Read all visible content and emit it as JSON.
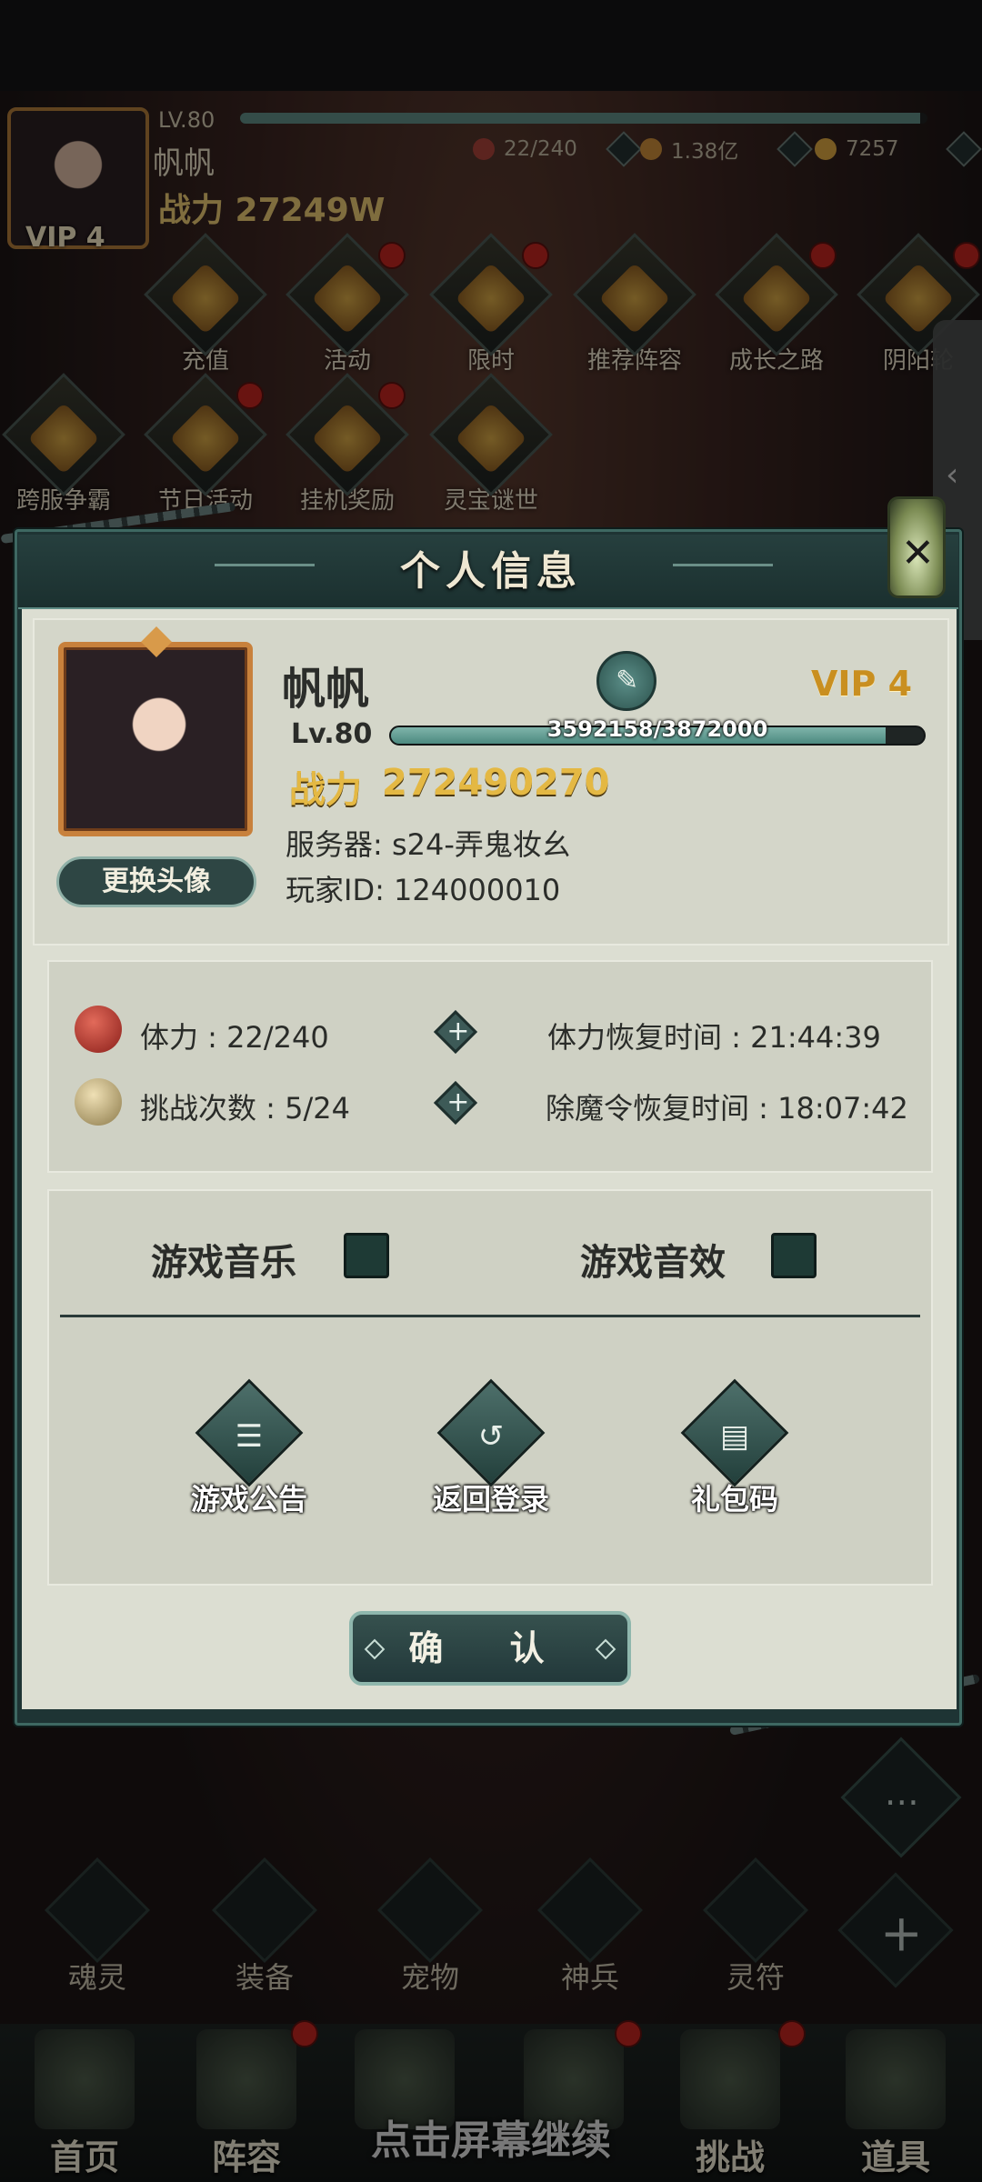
{
  "hud": {
    "level": "LV.80",
    "name": "帆帆",
    "power": "战力 27249W",
    "vip": "VIP 4",
    "xp_fraction": 0.99,
    "resources": [
      {
        "icon": "stamina-orb-icon",
        "value": "22/240",
        "color": "#a8423a"
      },
      {
        "icon": "coin-icon",
        "value": "1.38亿",
        "color": "#c88a3a"
      },
      {
        "icon": "gem-heart-icon",
        "value": "7257",
        "color": "#d9a441"
      }
    ]
  },
  "features": [
    {
      "label": "充值",
      "badge": false
    },
    {
      "label": "活动",
      "badge": true
    },
    {
      "label": "限时",
      "badge": true
    },
    {
      "label": "推荐阵容",
      "badge": false
    },
    {
      "label": "成长之路",
      "badge": true
    },
    {
      "label": "阴阳轮",
      "badge": true
    },
    {
      "label": "跨服争霸",
      "badge": false
    },
    {
      "label": "节日活动",
      "badge": true
    },
    {
      "label": "挂机奖励",
      "badge": true
    },
    {
      "label": "灵宝谜世",
      "badge": false
    }
  ],
  "modal": {
    "title": "个人信息",
    "close_icon": "close-icon",
    "player": {
      "name": "帆帆",
      "vip": "VIP 4",
      "level": "Lv.80",
      "exp_text": "3592158/3872000",
      "exp_current": 3592158,
      "exp_max": 3872000,
      "power_label": "战力",
      "power_value": "272490270",
      "server": "服务器: s24-弄鬼妆幺",
      "player_id": "玩家ID:  124000010",
      "change_avatar_label": "更换头像"
    },
    "stats": {
      "stamina": "体力 : 22/240",
      "stamina_recover": "体力恢复时间 : 21:44:39",
      "challenges": "挑战次数 : 5/24",
      "demon_recover": "除魔令恢复时间 : 18:07:42"
    },
    "settings": {
      "music_label": "游戏音乐",
      "music_enabled": false,
      "sfx_label": "游戏音效",
      "sfx_enabled": false
    },
    "actions": [
      {
        "icon": "announcement-icon",
        "label": "游戏公告"
      },
      {
        "icon": "return-login-icon",
        "label": "返回登录"
      },
      {
        "icon": "gift-code-icon",
        "label": "礼包码"
      }
    ],
    "confirm_label": "确 认"
  },
  "sub_menu": [
    "魂灵",
    "装备",
    "宠物",
    "神兵",
    "灵符"
  ],
  "nav": [
    "首页",
    "阵容",
    "",
    "",
    "挑战",
    "道具"
  ],
  "continue_hint": "点击屏幕继续"
}
